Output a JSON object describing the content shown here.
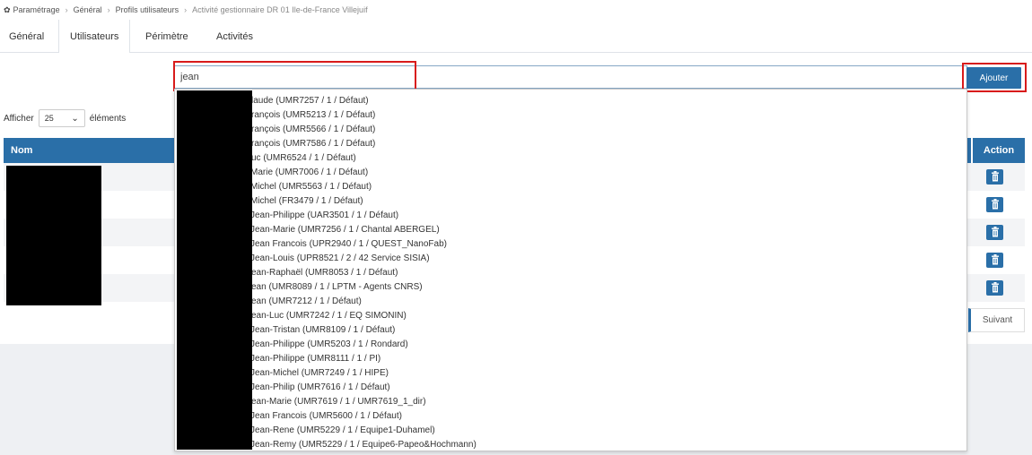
{
  "breadcrumb": [
    "Paramétrage",
    "Général",
    "Profils utilisateurs",
    "Activité gestionnaire DR 01 Ile-de-France Villejuif"
  ],
  "tabs": [
    "Général",
    "Utilisateurs",
    "Périmètre",
    "Activités"
  ],
  "active_tab": "Utilisateurs",
  "search": {
    "value": "jean"
  },
  "add_button": "Ajouter",
  "pagination": {
    "show_label": "Afficher",
    "page_size": "25",
    "items_label": "éléments",
    "next": "Suivant"
  },
  "table": {
    "columns": [
      "Nom",
      "Action"
    ],
    "row_count": 5
  },
  "dropdown": {
    "items": [
      "laude (UMR7257 / 1 / Défaut)",
      "rançois (UMR5213 / 1 / Défaut)",
      "rançois (UMR5566 / 1 / Défaut)",
      "rançois (UMR7586 / 1 / Défaut)",
      "uc (UMR6524 / 1 / Défaut)",
      "Marie (UMR7006 / 1 / Défaut)",
      "Michel (UMR5563 / 1 / Défaut)",
      "Michel (FR3479 / 1 / Défaut)",
      "Jean-Philippe (UAR3501 / 1 / Défaut)",
      "Jean-Marie (UMR7256 / 1 / Chantal ABERGEL)",
      "Jean Francois (UPR2940 / 1 / QUEST_NanoFab)",
      "Jean-Louis (UPR8521 / 2 / 42 Service SISIA)",
      "ean-Raphaël (UMR8053 / 1 / Défaut)",
      "ean (UMR8089 / 1 / LPTM - Agents CNRS)",
      "ean (UMR7212 / 1 / Défaut)",
      "ean-Luc (UMR7242 / 1 / EQ SIMONIN)",
      "Jean-Tristan (UMR8109 / 1 / Défaut)",
      "Jean-Philippe (UMR5203 / 1 / Rondard)",
      "Jean-Philippe (UMR8111 / 1 / PI)",
      "Jean-Michel (UMR7249 / 1 / HIPE)",
      "Jean-Philip (UMR7616 / 1 / Défaut)",
      "ean-Marie (UMR7619 / 1 / UMR7619_1_dir)",
      "Jean Francois (UMR5600 / 1 / Défaut)",
      "Jean-Rene (UMR5229 / 1 / Equipe1-Duhamel)",
      "Jean-Remy (UMR5229 / 1 / Equipe6-Papeo&Hochmann)"
    ]
  },
  "icons": {
    "breadcrumb": "gear-icon",
    "page_size": "chevron-down-icon",
    "row_action": "trash-icon"
  },
  "colors": {
    "primary": "#2a6fa8",
    "highlight_box": "#d81b1b",
    "redaction": "#000000"
  }
}
